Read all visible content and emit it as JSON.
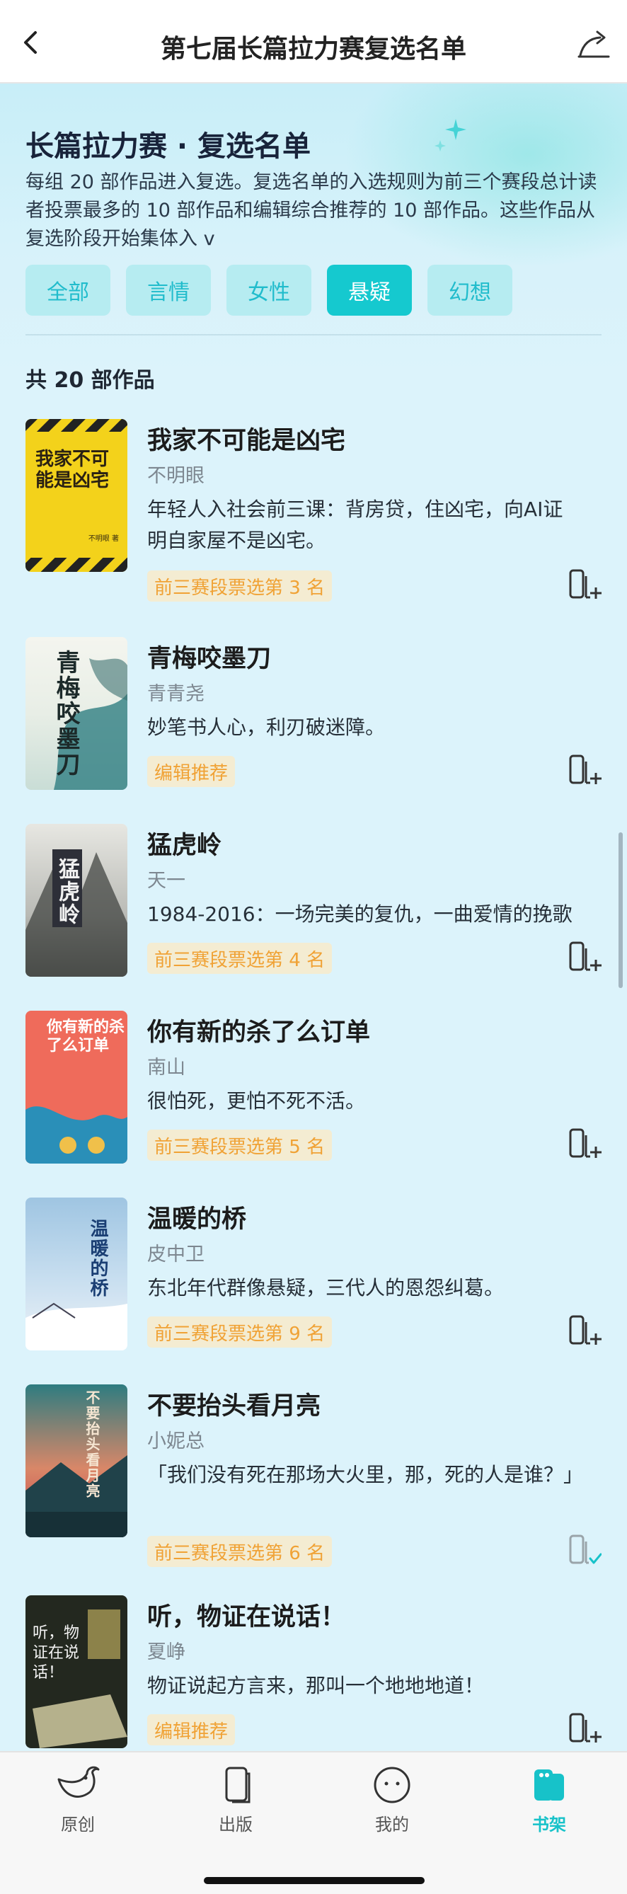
{
  "header": {
    "title": "第七届长篇拉力赛复选名单"
  },
  "intro": {
    "title": "长篇拉力赛 · 复选名单",
    "description": "每组 20 部作品进入复选。复选名单的入选规则为前三个赛段总计读者投票最多的 10 部作品和编辑综合推荐的 10 部作品。这些作品从复选阶段开始集体入 v"
  },
  "filters": [
    {
      "label": "全部",
      "active": false
    },
    {
      "label": "言情",
      "active": false
    },
    {
      "label": "女性",
      "active": false
    },
    {
      "label": "悬疑",
      "active": true
    },
    {
      "label": "幻想",
      "active": false
    }
  ],
  "count_label": "共 20 部作品",
  "books": [
    {
      "title": "我家不可能是凶宅",
      "author": "不明眼",
      "description": "年轻人入社会前三课：背房贷，住凶宅，向AI证明自家屋不是凶宅。",
      "tag": "前三赛段票选第 3 名",
      "cover_text": "我家不可能是凶宅",
      "cover_small": "不明眼 著",
      "added": false
    },
    {
      "title": "青梅咬墨刀",
      "author": "青青尧",
      "description": "妙笔书人心，利刃破迷障。",
      "tag": "编辑推荐",
      "cover_text": "青梅咬墨刀",
      "added": false
    },
    {
      "title": "猛虎岭",
      "author": "天一",
      "description": "1984-2016：一场完美的复仇，一曲爱情的挽歌",
      "tag": "前三赛段票选第 4 名",
      "cover_text": "猛虎岭",
      "added": false
    },
    {
      "title": "你有新的杀了么订单",
      "author": "南山",
      "description": "很怕死，更怕不死不活。",
      "tag": "前三赛段票选第 5 名",
      "cover_text": "你有新的杀了么订单",
      "added": false
    },
    {
      "title": "温暖的桥",
      "author": "皮中卫",
      "description": "东北年代群像悬疑，三代人的恩怨纠葛。",
      "tag": "前三赛段票选第 9 名",
      "cover_text": "温暖的桥",
      "added": false
    },
    {
      "title": "不要抬头看月亮",
      "author": "小妮总",
      "description": "「我们没有死在那场大火里，那，死的人是谁？」",
      "tag": "前三赛段票选第 6 名",
      "cover_text": "不要抬头看月亮",
      "added": true
    },
    {
      "title": "听，物证在说话！",
      "author": "夏峥",
      "description": "物证说起方言来，那叫一个地地地道！",
      "tag": "编辑推荐",
      "cover_text": "听，物证在说话！",
      "added": false
    }
  ],
  "nav": [
    {
      "label": "原创",
      "icon": "bird-icon",
      "active": false
    },
    {
      "label": "出版",
      "icon": "book-icon",
      "active": false
    },
    {
      "label": "我的",
      "icon": "face-icon",
      "active": false
    },
    {
      "label": "书架",
      "icon": "bookshelf-icon",
      "active": true
    }
  ],
  "colors": {
    "accent": "#15c9cf",
    "tag_text": "#f0a235",
    "tag_bg": "#f4ecd2",
    "page_bg": "#dcf3fb"
  }
}
